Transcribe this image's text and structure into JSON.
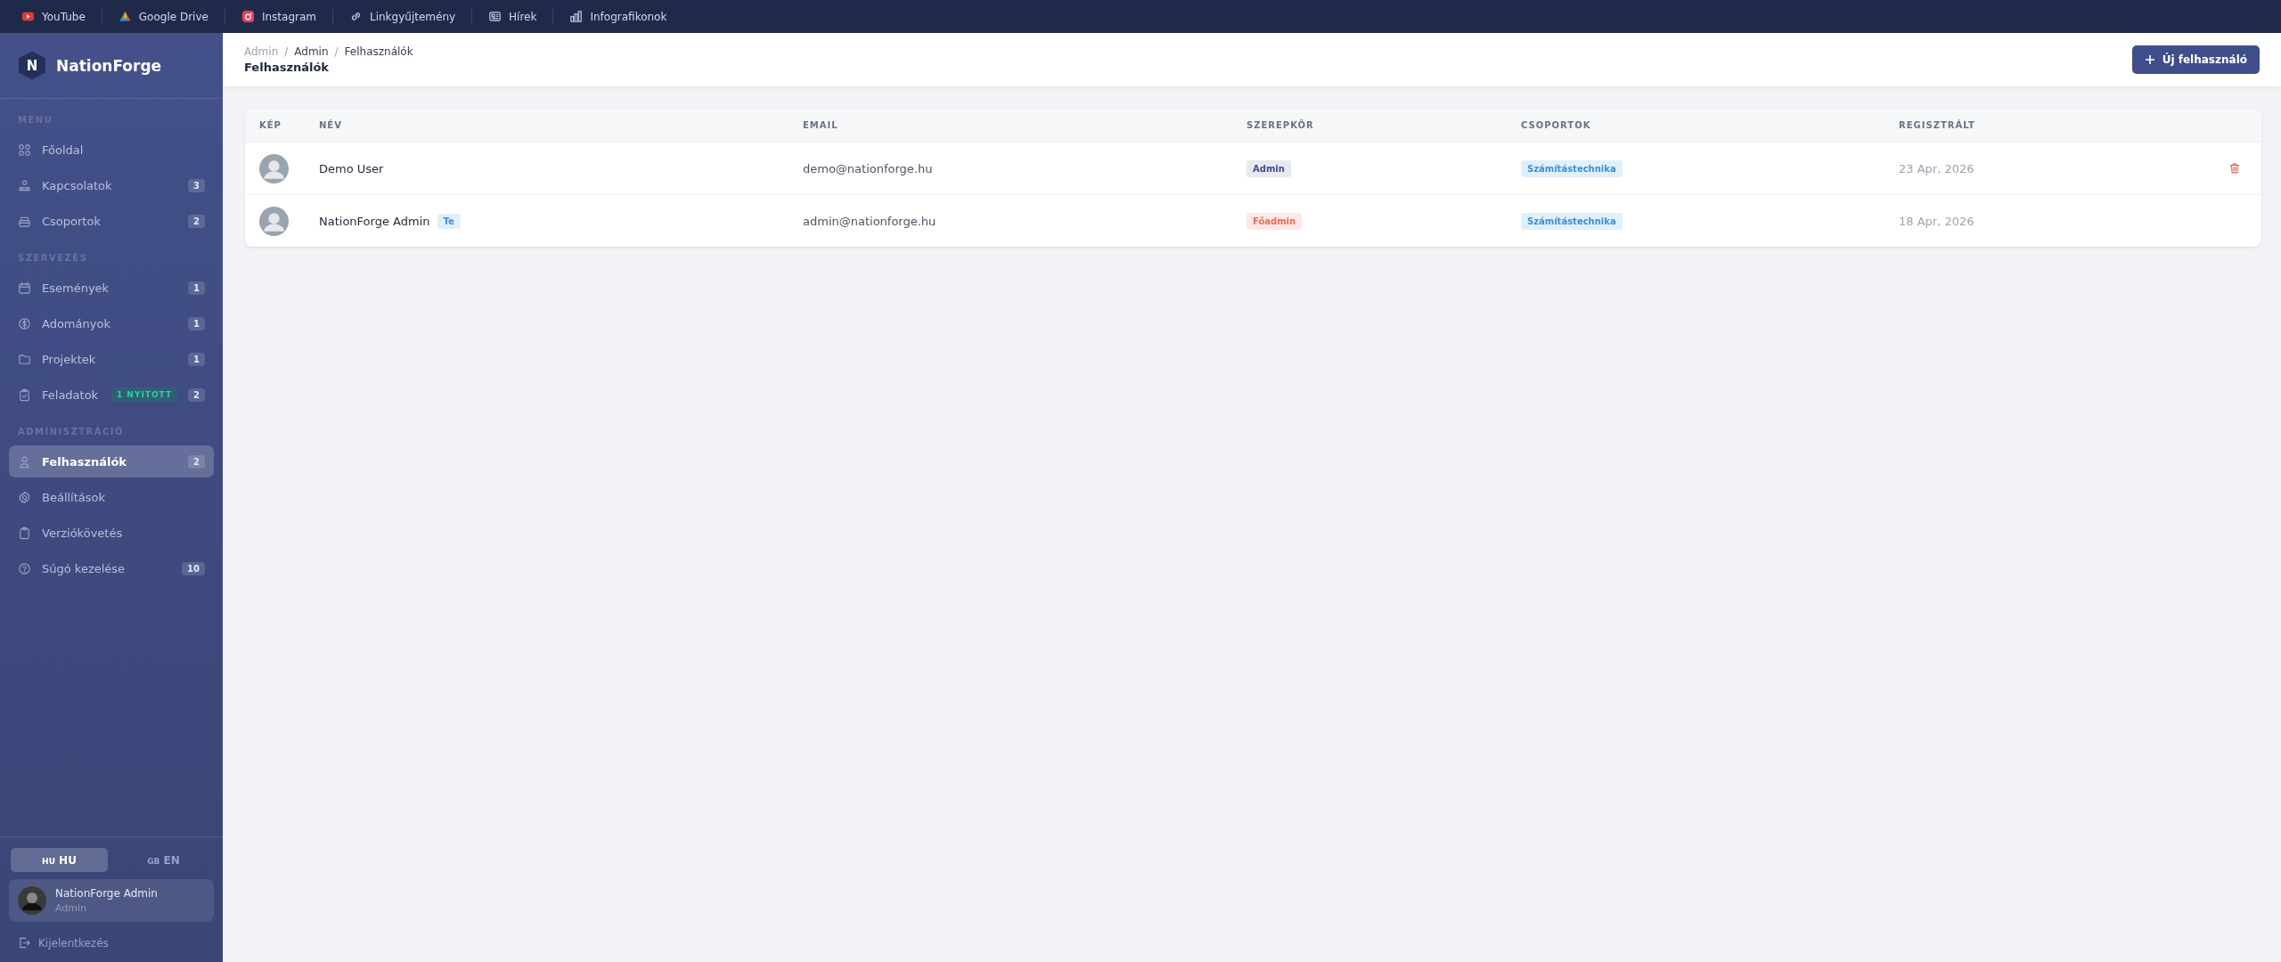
{
  "topbar": {
    "links": [
      {
        "label": "YouTube",
        "kind": "youtube"
      },
      {
        "label": "Google Drive",
        "kind": "drive"
      },
      {
        "label": "Instagram",
        "kind": "instagram"
      },
      {
        "label": "Linkgyűjtemény",
        "kind": "link"
      },
      {
        "label": "Hírek",
        "kind": "news"
      },
      {
        "label": "Infografikonok",
        "kind": "chart"
      }
    ]
  },
  "sidebar": {
    "brand": "NationForge",
    "brand_mark": "N",
    "sections": [
      {
        "title": "MENU",
        "items": [
          {
            "label": "Főoldal",
            "selected": false
          },
          {
            "label": "Kapcsolatok",
            "count": "3",
            "selected": false
          },
          {
            "label": "Csoportok",
            "count": "2",
            "selected": false
          }
        ]
      },
      {
        "title": "SZERVEZÉS",
        "items": [
          {
            "label": "Események",
            "count": "1",
            "selected": false
          },
          {
            "label": "Adományok",
            "count": "1",
            "selected": false
          },
          {
            "label": "Projektek",
            "count": "1",
            "selected": false
          },
          {
            "label": "Feladatok",
            "count": "2",
            "tag": "1 NYITOTT",
            "selected": false
          }
        ]
      },
      {
        "title": "ADMINISZTRÁCIÓ",
        "items": [
          {
            "label": "Felhasználók",
            "count": "2",
            "selected": true
          },
          {
            "label": "Beállítások",
            "selected": false
          },
          {
            "label": "Verziókövetés",
            "selected": false
          },
          {
            "label": "Súgó kezelése",
            "count": "10",
            "selected": false
          }
        ]
      }
    ],
    "languages": [
      {
        "flag": "HU",
        "label": "HU",
        "selected": true
      },
      {
        "flag": "GB",
        "label": "EN",
        "selected": false
      }
    ],
    "user": {
      "name": "NationForge Admin",
      "role": "Admin"
    },
    "logout": "Kijelentkezés"
  },
  "header": {
    "breadcrumb": [
      "Admin",
      "Admin",
      "Felhasználók"
    ],
    "breadcrumb_separator": "/",
    "title": "Felhasználók",
    "new_button": "Új felhasználó"
  },
  "table": {
    "columns": [
      "KÉP",
      "NÉV",
      "EMAIL",
      "SZEREPKÖR",
      "CSOPORTOK",
      "REGISZTRÁLT"
    ],
    "rows": [
      {
        "name": "Demo User",
        "badge": null,
        "email": "demo@nationforge.hu",
        "role": {
          "label": "Admin",
          "kind": "admin"
        },
        "group": "Számítástechnika",
        "registered": "23 Apr, 2026",
        "deletable": true
      },
      {
        "name": "NationForge Admin",
        "badge": "Te",
        "email": "admin@nationforge.hu",
        "role": {
          "label": "Főadmin",
          "kind": "superadmin"
        },
        "group": "Számítástechnika",
        "registered": "18 Apr, 2026",
        "deletable": false
      }
    ]
  }
}
